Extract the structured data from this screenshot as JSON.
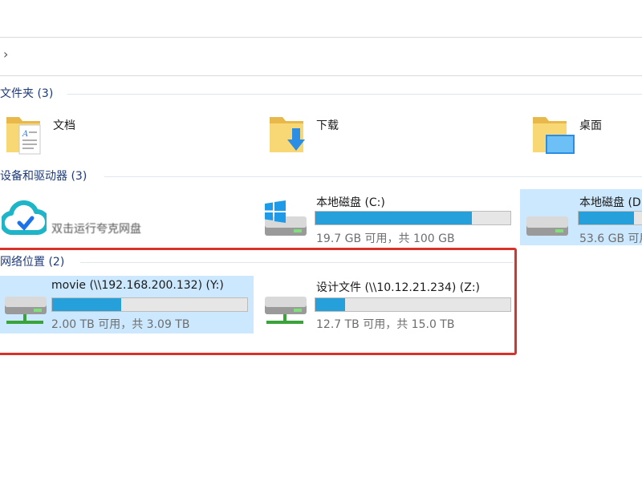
{
  "folders": {
    "header": "文件夹 (3)",
    "items": [
      {
        "label": "文档"
      },
      {
        "label": "下载"
      },
      {
        "label": "桌面"
      }
    ]
  },
  "devices": {
    "header": "设备和驱动器 (3)",
    "quark": {
      "label": "双击运行夸克网盘"
    },
    "drive_c": {
      "label": "本地磁盘 (C:)",
      "sub": "19.7 GB 可用，共 100 GB",
      "used_fraction": 0.803
    },
    "drive_d": {
      "label": "本地磁盘 (D",
      "sub": "53.6 GB 可用",
      "used_fraction": 0.7
    }
  },
  "network": {
    "header": "网络位置 (2)",
    "drive_y": {
      "label": "movie (\\\\192.168.200.132) (Y:)",
      "sub": "2.00 TB 可用，共 3.09 TB",
      "used_fraction": 0.353
    },
    "drive_z": {
      "label": "设计文件 (\\\\10.12.21.234) (Z:)",
      "sub": "12.7 TB 可用，共 15.0 TB",
      "used_fraction": 0.153
    }
  },
  "colors": {
    "accent": "#26a0da",
    "selection": "#cce8ff",
    "highlight_box": "#d9322b"
  }
}
